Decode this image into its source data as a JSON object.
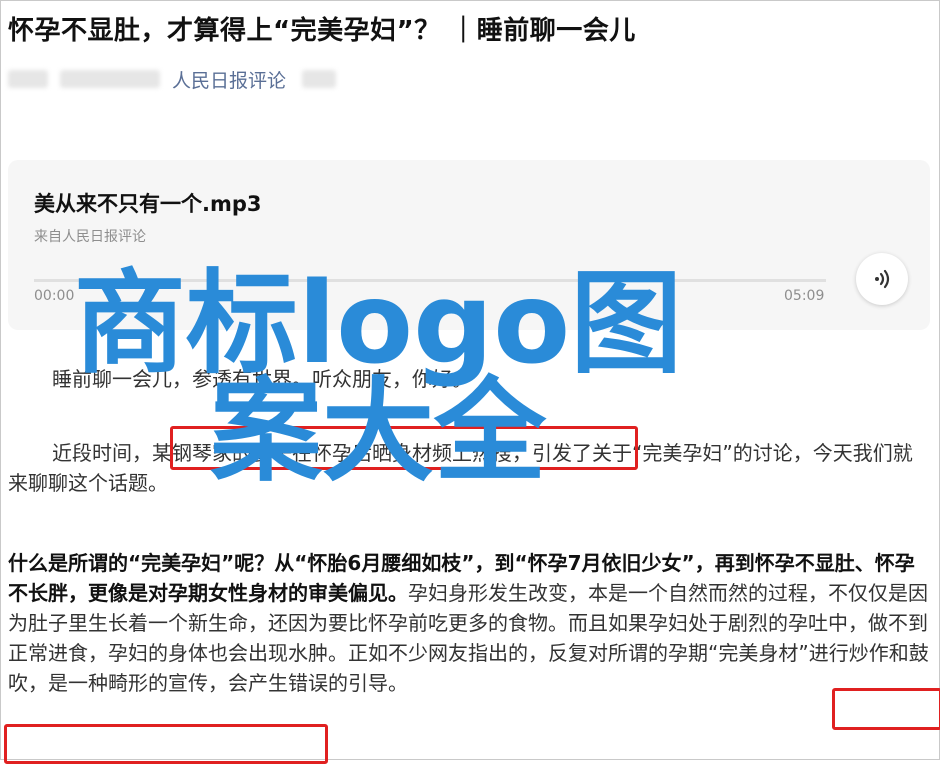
{
  "article": {
    "title": "怀孕不显肚，才算得上“完美孕妇”？ ｜睡前聊一会儿",
    "source": "人民日报评论"
  },
  "audio": {
    "track_title": "美从来不只有一个.mp3",
    "track_source": "来自人民日报评论",
    "time_current": "00:00",
    "time_total": "05:09",
    "progress": 0,
    "play_icon": "speaker-wave-icon"
  },
  "body": {
    "p1": "睡前聊一会儿，参透有世界。听众朋友，你好。",
    "p2": "近段时间，某钢琴家的妻子在怀孕后晒身材频上热搜，引发了关于“完美孕妇”的讨论，今天我们就来聊聊这个话题。",
    "p3_bold": "什么是所谓的“完美孕妇”呢？从“怀胎6月腰细如枝”，到“怀孕7月依旧少女”，再到怀孕不显肚、怀孕不长胖，更像是对孕期女性身材的审美偏见。",
    "p3_rest": "孕妇身形发生改变，本是一个自然而然的过程，不仅仅是因为肚子里生长着一个新生命，还因为要比怀孕前吃更多的食物。而且如果孕妇处于剧烈的孕吐中，做不到正常进食，孕妇的身体也会出现水肿。正如不少网友指出的，反复对所谓的孕期“完美身材”进行炒作和鼓吹，是一种畸形的宣传，会产生错误的引导。"
  },
  "watermark": {
    "line1": "商标logo图",
    "line2": "案大全"
  },
  "colors": {
    "highlight": "#e02020",
    "watermark": "#2a8bd8",
    "link": "#5a6f96"
  }
}
